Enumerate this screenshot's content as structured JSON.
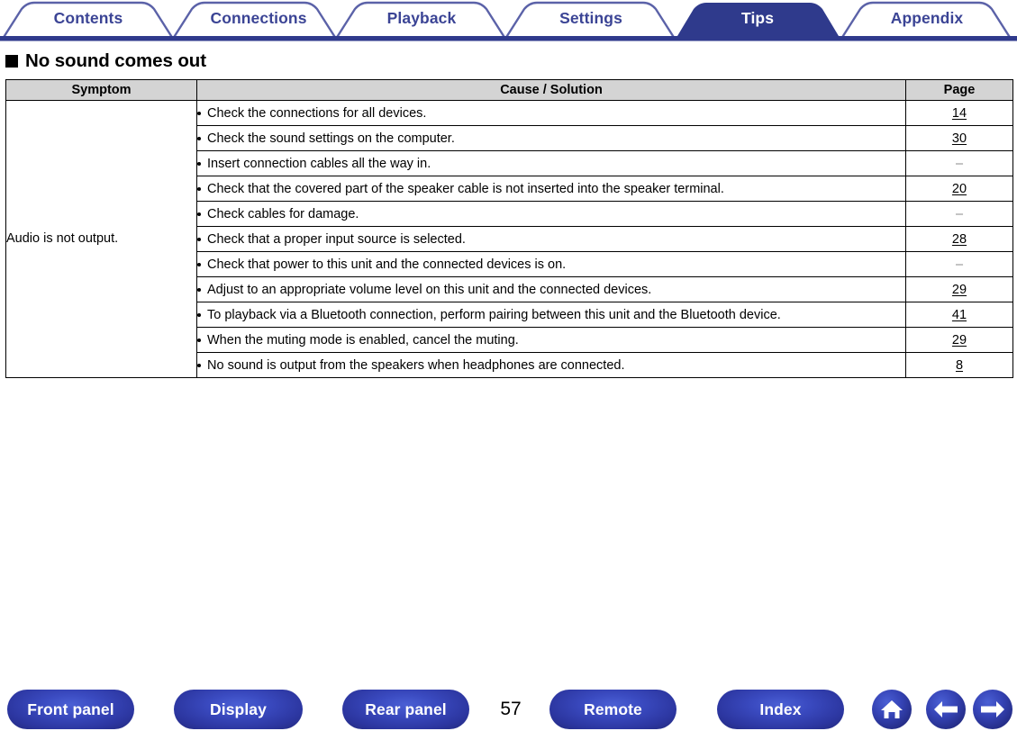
{
  "tabs": [
    {
      "label": "Contents",
      "active": false
    },
    {
      "label": "Connections",
      "active": false
    },
    {
      "label": "Playback",
      "active": false
    },
    {
      "label": "Settings",
      "active": false
    },
    {
      "label": "Tips",
      "active": true
    },
    {
      "label": "Appendix",
      "active": false
    }
  ],
  "heading": {
    "bullet": "black-square-icon",
    "text": "No sound comes out"
  },
  "table": {
    "columns": [
      "Symptom",
      "Cause / Solution",
      "Page"
    ],
    "symptom": "Audio is not output.",
    "rows": [
      {
        "cause": "Check the connections for all devices.",
        "page": "14",
        "is_link": true
      },
      {
        "cause": "Check the sound settings on the computer.",
        "page": "30",
        "is_link": true
      },
      {
        "cause": "Insert connection cables all the way in.",
        "page": "–",
        "is_link": false
      },
      {
        "cause": "Check that the covered part of the speaker cable is not inserted into the speaker terminal.",
        "page": "20",
        "is_link": true
      },
      {
        "cause": "Check cables for damage.",
        "page": "–",
        "is_link": false
      },
      {
        "cause": "Check that a proper input source is selected.",
        "page": "28",
        "is_link": true
      },
      {
        "cause": "Check that power to this unit and the connected devices is on.",
        "page": "–",
        "is_link": false
      },
      {
        "cause": "Adjust to an appropriate volume level on this unit and the connected devices.",
        "page": "29",
        "is_link": true
      },
      {
        "cause": "To playback via a Bluetooth connection, perform pairing between this unit and the Bluetooth device.",
        "page": "41",
        "is_link": true
      },
      {
        "cause": "When the muting mode is enabled, cancel the muting.",
        "page": "29",
        "is_link": true
      },
      {
        "cause": "No sound is output from the speakers when headphones are connected.",
        "page": "8",
        "is_link": true
      }
    ]
  },
  "footer": {
    "buttons": [
      {
        "label": "Front panel"
      },
      {
        "label": "Display"
      },
      {
        "label": "Rear panel"
      },
      {
        "label": "Remote"
      },
      {
        "label": "Index"
      }
    ],
    "page_number": "57",
    "icons": [
      {
        "name": "home-icon"
      },
      {
        "name": "arrow-left-icon"
      },
      {
        "name": "arrow-right-icon"
      }
    ]
  },
  "colors": {
    "brand_blue": "#3b4495",
    "active_tab": "#2f3a8c",
    "header_gray": "#d4d4d4",
    "dash_gray": "#8a8a8a"
  }
}
